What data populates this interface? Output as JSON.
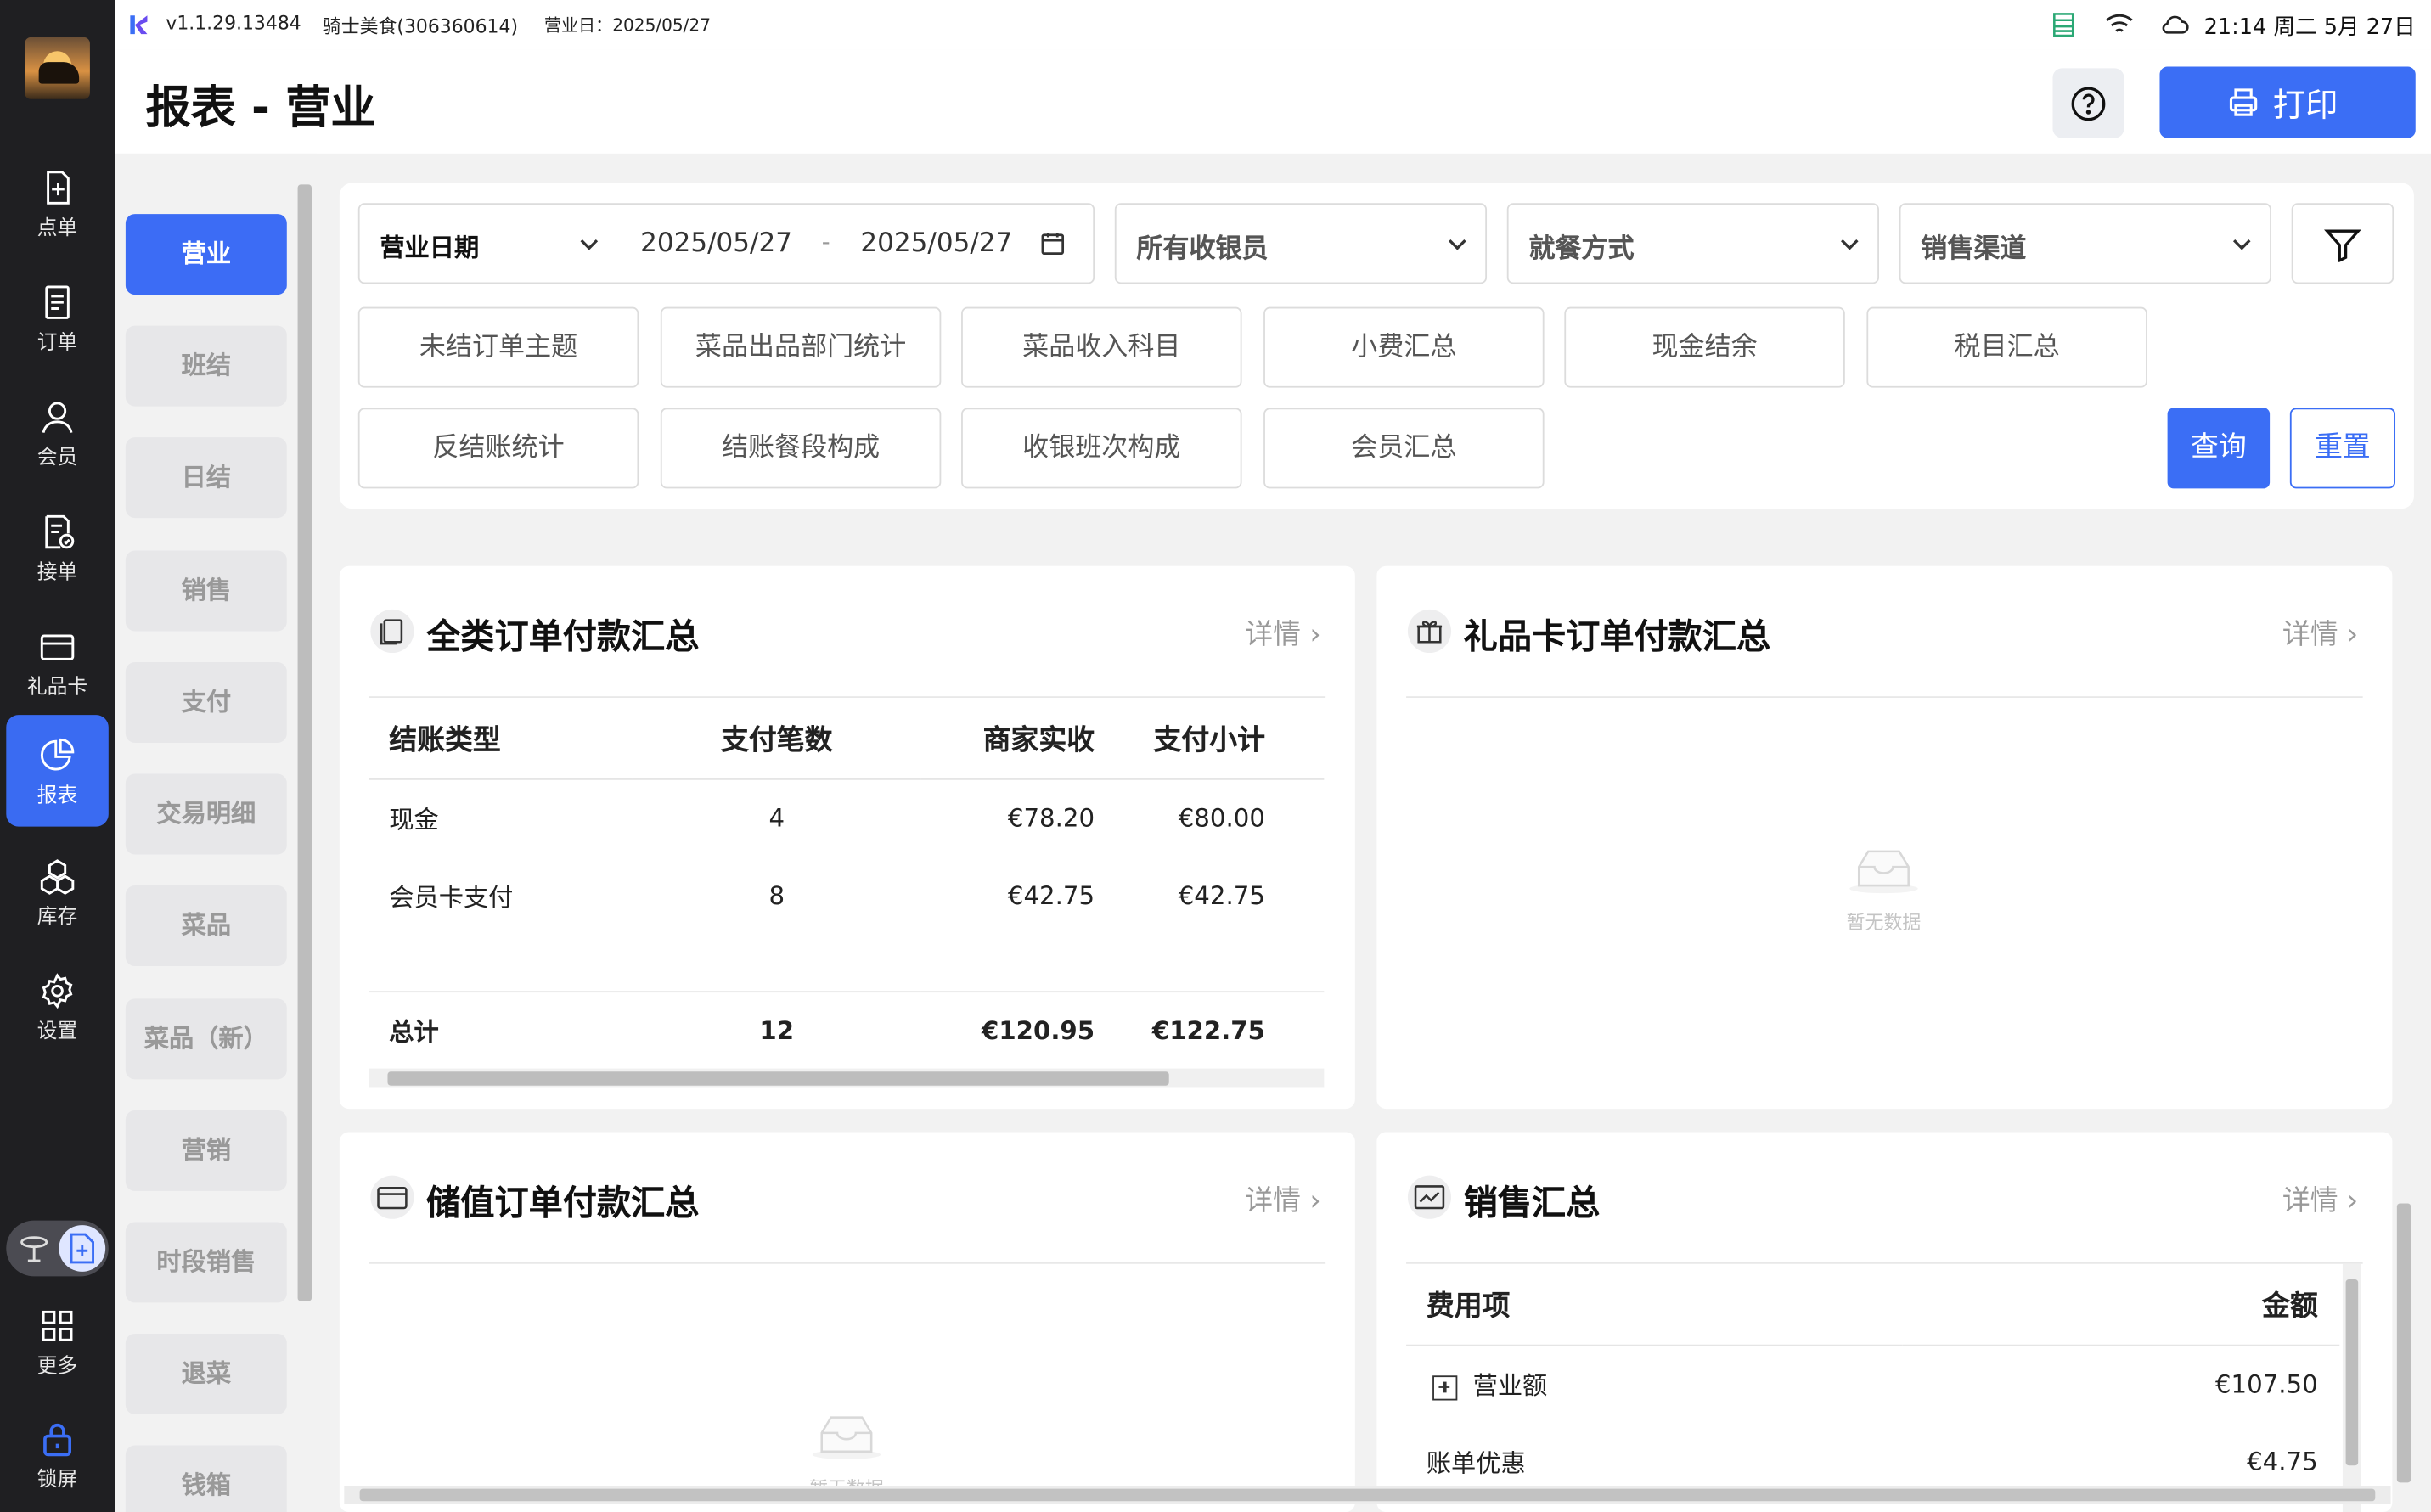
{
  "status_bar": {
    "version": "v1.1.29.13484",
    "store": "骑士美食(306360614)",
    "business_day": "营业日：2025/05/27",
    "datetime": "21:14 周二 5月 27日"
  },
  "header": {
    "title": "报表 - 营业",
    "print_label": "打印"
  },
  "nav": {
    "items": [
      {
        "label": "点单",
        "icon": "add-order-icon"
      },
      {
        "label": "订单",
        "icon": "order-list-icon"
      },
      {
        "label": "会员",
        "icon": "member-icon"
      },
      {
        "label": "接单",
        "icon": "accept-order-icon"
      },
      {
        "label": "礼品卡",
        "icon": "gift-card-icon"
      },
      {
        "label": "报表",
        "icon": "report-pie-icon"
      },
      {
        "label": "库存",
        "icon": "inventory-icon"
      },
      {
        "label": "设置",
        "icon": "settings-gear-icon"
      },
      {
        "label": "更多",
        "icon": "grid-more-icon"
      },
      {
        "label": "锁屏",
        "icon": "lock-icon"
      }
    ],
    "active": "报表"
  },
  "subnav": {
    "items": [
      "营业",
      "班结",
      "日结",
      "销售",
      "支付",
      "交易明细",
      "菜品",
      "菜品（新）",
      "营销",
      "时段销售",
      "退菜",
      "钱箱"
    ],
    "active": "营业"
  },
  "filter": {
    "date_type": "营业日期",
    "date_from": "2025/05/27",
    "date_sep": "-",
    "date_to": "2025/05/27",
    "cashier": "所有收银员",
    "dining_mode": "就餐方式",
    "sales_channel": "销售渠道",
    "chips": [
      "未结订单主题",
      "菜品出品部门统计",
      "菜品收入科目",
      "小费汇总",
      "现金结余",
      "税目汇总",
      "反结账统计",
      "结账餐段构成",
      "收银班次构成",
      "会员汇总"
    ],
    "query_label": "查询",
    "reset_label": "重置"
  },
  "cards": {
    "all_orders": {
      "title": "全类订单付款汇总",
      "more": "详情",
      "columns": [
        "结账类型",
        "支付笔数",
        "商家实收",
        "支付小计"
      ],
      "rows": [
        [
          "现金",
          "4",
          "€78.20",
          "€80.00"
        ],
        [
          "会员卡支付",
          "8",
          "€42.75",
          "€42.75"
        ]
      ],
      "total": [
        "总计",
        "12",
        "€120.95",
        "€122.75"
      ]
    },
    "gift_card": {
      "title": "礼品卡订单付款汇总",
      "more": "详情",
      "empty": "暂无数据"
    },
    "stored_value": {
      "title": "储值订单付款汇总",
      "more": "详情",
      "empty": "暂无数据"
    },
    "sales_summary": {
      "title": "销售汇总",
      "more": "详情",
      "columns": [
        "费用项",
        "金额"
      ],
      "rows": [
        [
          "营业额",
          "€107.50"
        ],
        [
          "账单优惠",
          "€4.75"
        ]
      ]
    }
  },
  "colors": {
    "accent": "#3b6ef5",
    "nav_bg": "#1f1f22"
  }
}
